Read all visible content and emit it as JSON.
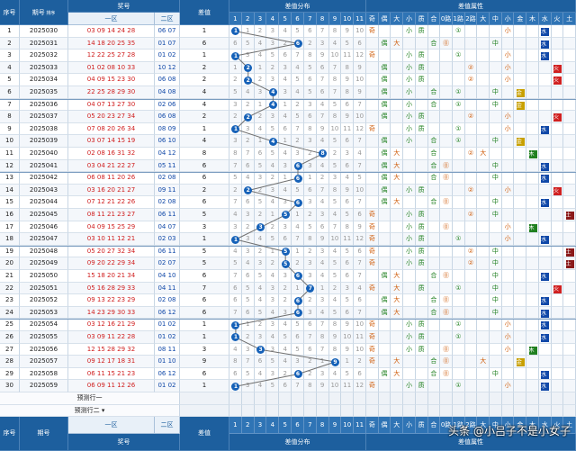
{
  "header": {
    "xuhao": "序号",
    "qihao": "期号",
    "paixu": "排序",
    "jianghao": "奖号",
    "yiqu": "一区",
    "erqu": "二区",
    "chazhi": "差值",
    "fenbu": "差值分布",
    "shuxing": "差值属性",
    "fenbu_cols": [
      "1",
      "2",
      "3",
      "4",
      "5",
      "6",
      "7",
      "8",
      "9",
      "10",
      "11"
    ],
    "attr_cols": [
      "奇",
      "偶",
      "大",
      "小",
      "质",
      "合",
      "0路",
      "1路",
      "2路",
      "大",
      "中",
      "小",
      "金",
      "木",
      "水",
      "火",
      "土"
    ]
  },
  "footer": {
    "xuhao": "序号",
    "qihao": "期号",
    "jianghao": "奖号",
    "yiqu": "一区",
    "erqu": "二区",
    "chazhi": "差值",
    "fenbu": "差值分布",
    "shuxing": "差值属性",
    "predict1": "预测行一",
    "predict2": "预测行二"
  },
  "rows": [
    {
      "n": "1",
      "q": "2025030",
      "f": "03 09 14 24 28",
      "b": "06 07",
      "d": 1
    },
    {
      "n": "2",
      "q": "2025031",
      "f": "14 18 20 25 35",
      "b": "01 07",
      "d": 6
    },
    {
      "n": "3",
      "q": "2025032",
      "f": "12 22 25 27 28",
      "b": "01 02",
      "d": 1
    },
    {
      "n": "4",
      "q": "2025033",
      "f": "01 02 08 10 33",
      "b": "10 12",
      "d": 2
    },
    {
      "n": "5",
      "q": "2025034",
      "f": "04 09 15 23 30",
      "b": "06 08",
      "d": 2
    },
    {
      "n": "6",
      "q": "2025035",
      "f": "22 25 28 29 30",
      "b": "04 08",
      "d": 4
    },
    {
      "n": "7",
      "q": "2025036",
      "f": "04 07 13 27 30",
      "b": "02 06",
      "d": 4
    },
    {
      "n": "8",
      "q": "2025037",
      "f": "05 20 23 27 34",
      "b": "06 08",
      "d": 2
    },
    {
      "n": "9",
      "q": "2025038",
      "f": "07 08 20 26 34",
      "b": "08 09",
      "d": 1
    },
    {
      "n": "10",
      "q": "2025039",
      "f": "03 07 14 15 19",
      "b": "06 10",
      "d": 4
    },
    {
      "n": "11",
      "q": "2025040",
      "f": "02 08 16 31 32",
      "b": "04 12",
      "d": 8
    },
    {
      "n": "12",
      "q": "2025041",
      "f": "03 04 21 22 27",
      "b": "05 11",
      "d": 6
    },
    {
      "n": "13",
      "q": "2025042",
      "f": "06 08 11 20 26",
      "b": "02 08",
      "d": 6
    },
    {
      "n": "14",
      "q": "2025043",
      "f": "03 16 20 21 27",
      "b": "09 11",
      "d": 2
    },
    {
      "n": "15",
      "q": "2025044",
      "f": "07 12 21 22 26",
      "b": "02 08",
      "d": 6
    },
    {
      "n": "16",
      "q": "2025045",
      "f": "08 11 21 23 27",
      "b": "06 11",
      "d": 5
    },
    {
      "n": "17",
      "q": "2025046",
      "f": "04 09 15 25 29",
      "b": "04 07",
      "d": 3
    },
    {
      "n": "18",
      "q": "2025047",
      "f": "03 10 11 12 21",
      "b": "02 03",
      "d": 1
    },
    {
      "n": "19",
      "q": "2025048",
      "f": "05 20 27 32 34",
      "b": "06 11",
      "d": 5
    },
    {
      "n": "20",
      "q": "2025049",
      "f": "09 20 22 29 34",
      "b": "02 07",
      "d": 5
    },
    {
      "n": "21",
      "q": "2025050",
      "f": "15 18 20 21 34",
      "b": "04 10",
      "d": 6
    },
    {
      "n": "22",
      "q": "2025051",
      "f": "05 16 28 29 33",
      "b": "04 11",
      "d": 7
    },
    {
      "n": "23",
      "q": "2025052",
      "f": "09 13 22 23 29",
      "b": "02 08",
      "d": 6
    },
    {
      "n": "24",
      "q": "2025053",
      "f": "14 23 29 30 33",
      "b": "06 12",
      "d": 6
    },
    {
      "n": "25",
      "q": "2025054",
      "f": "03 12 16 21 29",
      "b": "01 02",
      "d": 1
    },
    {
      "n": "26",
      "q": "2025055",
      "f": "03 09 11 22 28",
      "b": "01 02",
      "d": 1
    },
    {
      "n": "27",
      "q": "2025056",
      "f": "12 15 28 29 32",
      "b": "08 11",
      "d": 3
    },
    {
      "n": "28",
      "q": "2025057",
      "f": "09 12 17 18 31",
      "b": "01 10",
      "d": 9
    },
    {
      "n": "29",
      "q": "2025058",
      "f": "06 11 15 21 23",
      "b": "06 12",
      "d": 6
    },
    {
      "n": "30",
      "q": "2025059",
      "f": "06 09 11 12 26",
      "b": "01 02",
      "d": 1
    }
  ],
  "watermark": "头条 @小吕子不是小女子",
  "colors": {
    "header": "#1d5f9e",
    "ball": "#1561b8",
    "odd": "#d06010",
    "even": "#208020",
    "fire": "#d02020",
    "wood": "#208020",
    "water": "#1048a8",
    "metal": "#c8a000",
    "earth": "#8b1a1a"
  }
}
